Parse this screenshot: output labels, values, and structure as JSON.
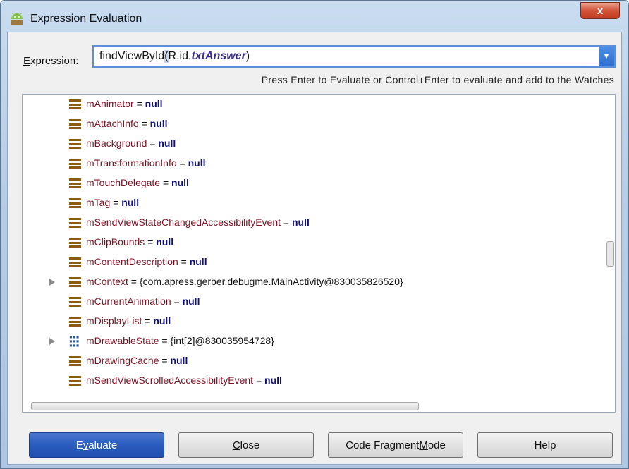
{
  "window": {
    "title": "Expression Evaluation",
    "close_glyph": "x"
  },
  "expression": {
    "label_prefix": "",
    "label_accel": "E",
    "label_rest": "xpression:",
    "value_plain": "findViewById",
    "value_paren": "(",
    "value_mid": "R.id.",
    "value_italic": "txtAnswer",
    "value_close": ")",
    "dropdown_glyph": "▼",
    "hint": "Press Enter to Evaluate or Control+Enter to evaluate and add to the Watches"
  },
  "tree": {
    "rows": [
      {
        "name": "mAnimator",
        "eq": " = ",
        "value": "null",
        "kind": "null",
        "icon": "field-icon",
        "expandable": false
      },
      {
        "name": "mAttachInfo",
        "eq": " = ",
        "value": "null",
        "kind": "null",
        "icon": "field-icon",
        "expandable": false
      },
      {
        "name": "mBackground",
        "eq": " = ",
        "value": "null",
        "kind": "null",
        "icon": "field-icon",
        "expandable": false
      },
      {
        "name": "mTransformationInfo",
        "eq": " = ",
        "value": "null",
        "kind": "null",
        "icon": "field-icon",
        "expandable": false
      },
      {
        "name": "mTouchDelegate",
        "eq": " = ",
        "value": "null",
        "kind": "null",
        "icon": "field-icon",
        "expandable": false
      },
      {
        "name": "mTag",
        "eq": " = ",
        "value": "null",
        "kind": "null",
        "icon": "field-icon",
        "expandable": false
      },
      {
        "name": "mSendViewStateChangedAccessibilityEvent",
        "eq": " = ",
        "value": "null",
        "kind": "null",
        "icon": "field-icon",
        "expandable": false
      },
      {
        "name": "mClipBounds",
        "eq": " = ",
        "value": "null",
        "kind": "null",
        "icon": "field-icon",
        "expandable": false
      },
      {
        "name": "mContentDescription",
        "eq": " = ",
        "value": "null",
        "kind": "null",
        "icon": "field-icon",
        "expandable": false
      },
      {
        "name": "mContext",
        "eq": " = ",
        "value": "{com.apress.gerber.debugme.MainActivity@830035826520}",
        "kind": "obj",
        "icon": "field-icon",
        "expandable": true
      },
      {
        "name": "mCurrentAnimation",
        "eq": " = ",
        "value": "null",
        "kind": "null",
        "icon": "field-icon",
        "expandable": false
      },
      {
        "name": "mDisplayList",
        "eq": " = ",
        "value": "null",
        "kind": "null",
        "icon": "field-icon",
        "expandable": false
      },
      {
        "name": "mDrawableState",
        "eq": " = ",
        "value": "{int[2]@830035954728}",
        "kind": "obj",
        "icon": "array-icon",
        "expandable": true
      },
      {
        "name": "mDrawingCache",
        "eq": " = ",
        "value": "null",
        "kind": "null",
        "icon": "field-icon",
        "expandable": false
      },
      {
        "name": "mSendViewScrolledAccessibilityEvent",
        "eq": " = ",
        "value": "null",
        "kind": "null",
        "icon": "field-icon",
        "expandable": false
      }
    ]
  },
  "buttons": {
    "evaluate": {
      "accel": "v",
      "pre": "E",
      "post": "aluate"
    },
    "close": {
      "accel": "C",
      "pre": "",
      "post": "lose"
    },
    "code_fragment": {
      "pre": "Code Fragment ",
      "accel": "M",
      "post": "ode"
    },
    "help": {
      "pre": "Help",
      "accel": "",
      "post": ""
    }
  },
  "colors": {
    "field_name": "#7a1020",
    "null_value": "#10107a",
    "primary_button": "#2a5cbe",
    "title_bar": "#c9dcf0"
  }
}
